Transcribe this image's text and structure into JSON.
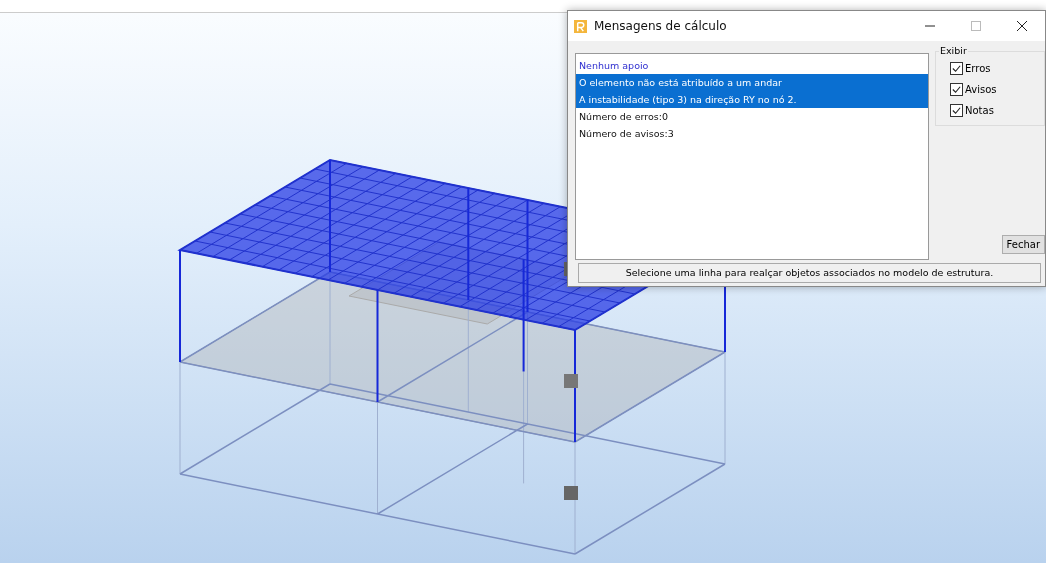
{
  "window": {
    "title": "Mensagens de cálculo"
  },
  "messages": [
    {
      "text": "Nenhum apoio",
      "kind": "heading",
      "selected": false
    },
    {
      "text": "O elemento não está atribuído a um andar",
      "kind": "message",
      "selected": true
    },
    {
      "text": "A instabilidade (tipo 3) na direção RY no nó 2.",
      "kind": "message",
      "selected": true
    },
    {
      "text": "Número de erros:0",
      "kind": "message",
      "selected": false
    },
    {
      "text": "Número de avisos:3",
      "kind": "message",
      "selected": false
    }
  ],
  "filter": {
    "title": "Exibir",
    "options": [
      {
        "label": "Erros",
        "checked": true
      },
      {
        "label": "Avisos",
        "checked": true
      },
      {
        "label": "Notas",
        "checked": true
      }
    ]
  },
  "buttons": [
    "Fechar"
  ],
  "status_bar": "Selecione uma linha para realçar objetos associados no modelo de estrutura."
}
